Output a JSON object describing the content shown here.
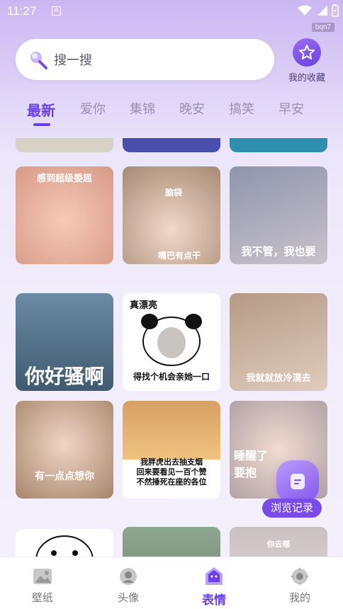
{
  "status_bar": {
    "time": "11:27",
    "notif_icon": "A",
    "tag": "bqn7"
  },
  "search": {
    "placeholder": "搜一搜"
  },
  "favorites": {
    "label": "我的收藏"
  },
  "tabs": [
    {
      "label": "最新",
      "active": true
    },
    {
      "label": "爱你"
    },
    {
      "label": "集锦"
    },
    {
      "label": "晚安"
    },
    {
      "label": "搞笑"
    },
    {
      "label": "早安"
    }
  ],
  "cards": {
    "row1": [
      "感到超级委屈",
      "脑袋",
      "嘴巴有点干",
      "我不管，我也要"
    ],
    "row2": [
      "你好骚啊",
      "真漂亮",
      "得找个机会亲她一口",
      "我就就放冷漠去"
    ],
    "row3": [
      "有一点点想你",
      "我胖虎出去抽支烟",
      "回来要看见一百个赞",
      "不然捶死在座的各位",
      "睡醒了",
      "要抱",
      "你去哪"
    ]
  },
  "history": {
    "label": "浏览记录"
  },
  "bottom_nav": [
    {
      "label": "壁纸",
      "icon": "wallpaper-icon"
    },
    {
      "label": "头像",
      "icon": "avatar-icon"
    },
    {
      "label": "表情",
      "icon": "emoji-icon",
      "active": true
    },
    {
      "label": "我的",
      "icon": "profile-icon"
    }
  ],
  "colors": {
    "accent": "#6a40e6",
    "tab_inactive": "#9b8fb4"
  }
}
